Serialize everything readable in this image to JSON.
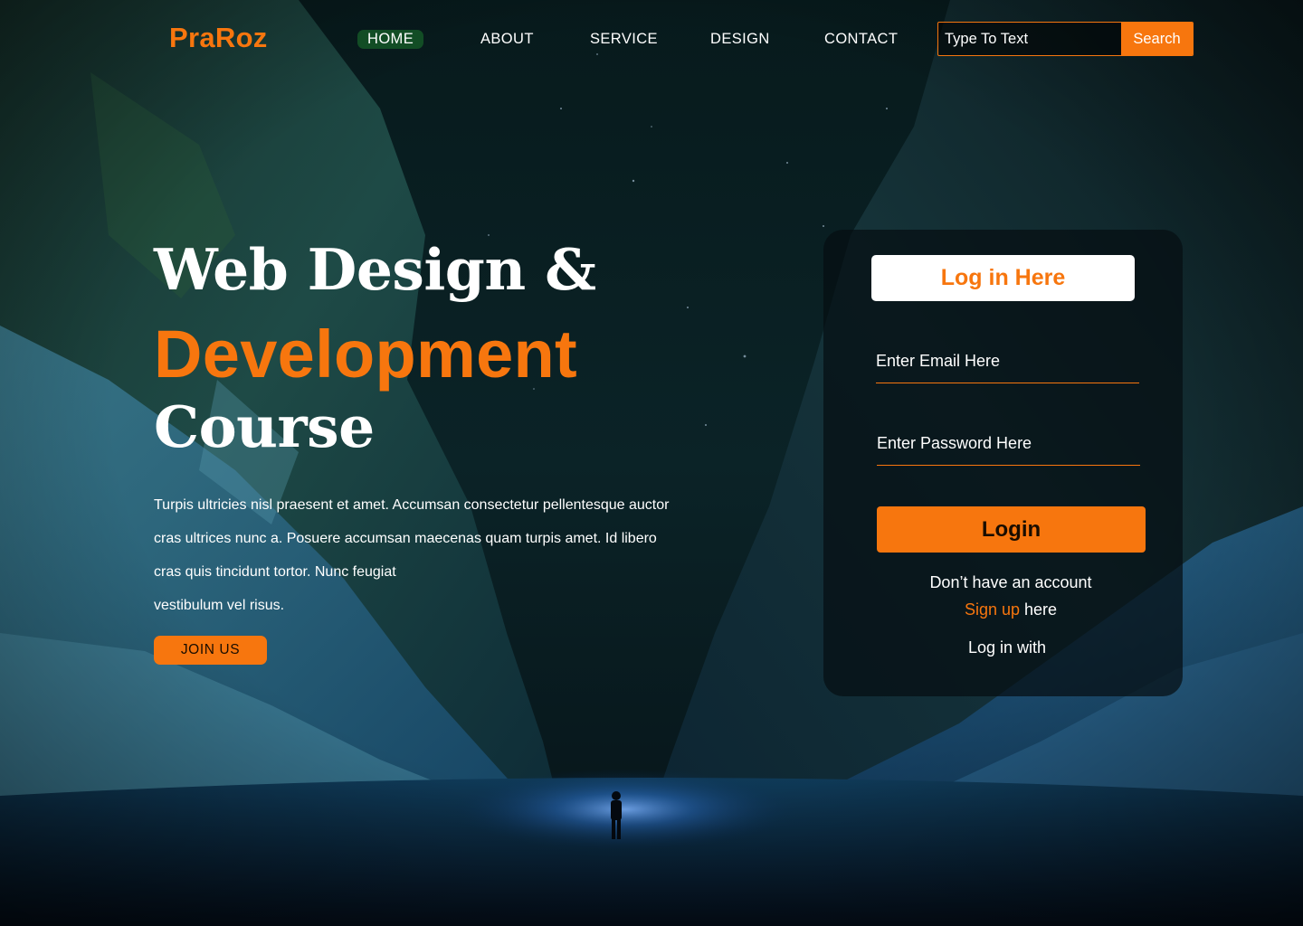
{
  "brand": {
    "logo": "PraRoz"
  },
  "nav": {
    "items": [
      {
        "label": "HOME",
        "active": true
      },
      {
        "label": "ABOUT",
        "active": false
      },
      {
        "label": "SERVICE",
        "active": false
      },
      {
        "label": "DESIGN",
        "active": false
      },
      {
        "label": "CONTACT",
        "active": false
      }
    ],
    "search": {
      "placeholder": "Type To Text",
      "button_label": "Search"
    }
  },
  "hero": {
    "title_line1": "Web Design &",
    "title_line2": "Development",
    "title_line3": "Course",
    "paragraph_lines": [
      "Turpis ultricies nisl praesent et amet. Accumsan consectetur pellentesque auctor",
      "cras ultrices nunc a. Posuere accumsan maecenas quam turpis amet. Id libero",
      "cras quis tincidunt tortor. Nunc feugiat",
      "vestibulum vel risus."
    ],
    "join_button": "JOIN US"
  },
  "login": {
    "title": "Log in Here",
    "email_placeholder": "Enter Email Here",
    "password_placeholder": "Enter Password Here",
    "login_button": "Login",
    "no_account_text": "Don’t have an account",
    "signup_link": "Sign up",
    "signup_suffix": " here",
    "login_with": "Log in with"
  },
  "colors": {
    "accent": "#f7760e",
    "nav_active_bg": "#124d25",
    "card_bg": "#050e12",
    "background": "#06141a"
  }
}
